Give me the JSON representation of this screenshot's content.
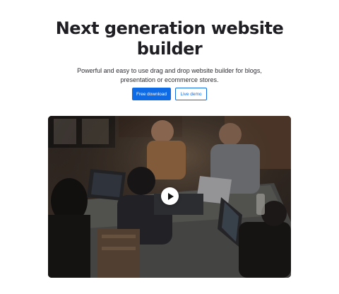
{
  "hero": {
    "title_line1": "Next generation website",
    "title_line2": "builder",
    "subtitle": "Powerful and easy to use drag and drop website builder for blogs, presentation or ecommerce stores."
  },
  "buttons": {
    "primary_label": "Free download",
    "secondary_label": "Live demo"
  },
  "colors": {
    "accent": "#0f6ae6",
    "title": "#1f1f23"
  },
  "video": {
    "thumbnail_subject": "team-working-at-laptops-photo",
    "play_icon": "play-icon"
  }
}
